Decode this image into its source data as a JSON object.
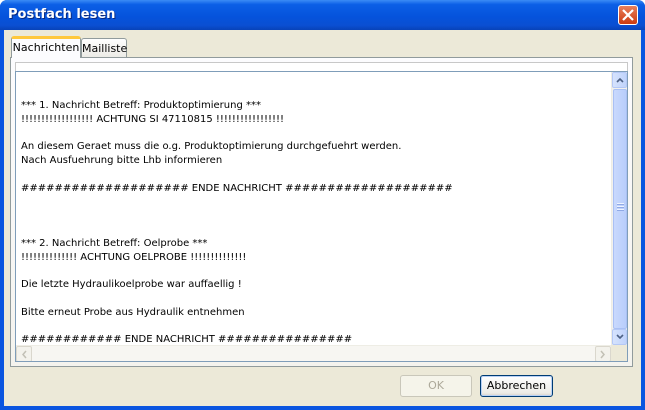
{
  "window": {
    "title": "Postfach lesen",
    "close_icon": "close-icon"
  },
  "tabs": [
    {
      "label": "Nachrichten",
      "active": true
    },
    {
      "label": "Mailliste",
      "active": false
    }
  ],
  "message_lines": [
    "",
    "*** 1. Nachricht Betreff: Produktoptimierung ***",
    "!!!!!!!!!!!!!!!!!! ACHTUNG SI 47110815 !!!!!!!!!!!!!!!!!",
    "",
    "An diesem Geraet muss die o.g. Produktoptimierung durchgefuehrt werden.",
    "Nach Ausfuehrung bitte Lhb informieren",
    "",
    "#################### ENDE NACHRICHT ####################",
    "",
    "",
    "",
    "*** 2. Nachricht Betreff: Oelprobe ***",
    "!!!!!!!!!!!!!! ACHTUNG OELPROBE !!!!!!!!!!!!!!",
    "",
    "Die letzte Hydraulikoelprobe war auffaellig !",
    "",
    "Bitte erneut Probe aus Hydraulik entnehmen",
    "",
    "############ ENDE NACHRICHT ################"
  ],
  "buttons": {
    "ok_label": "OK",
    "ok_enabled": false,
    "cancel_label": "Abbrechen"
  },
  "colors": {
    "titlebar": "#0553dc",
    "active_tab_accent": "#ffc83c",
    "close_button": "#cc3a10"
  }
}
